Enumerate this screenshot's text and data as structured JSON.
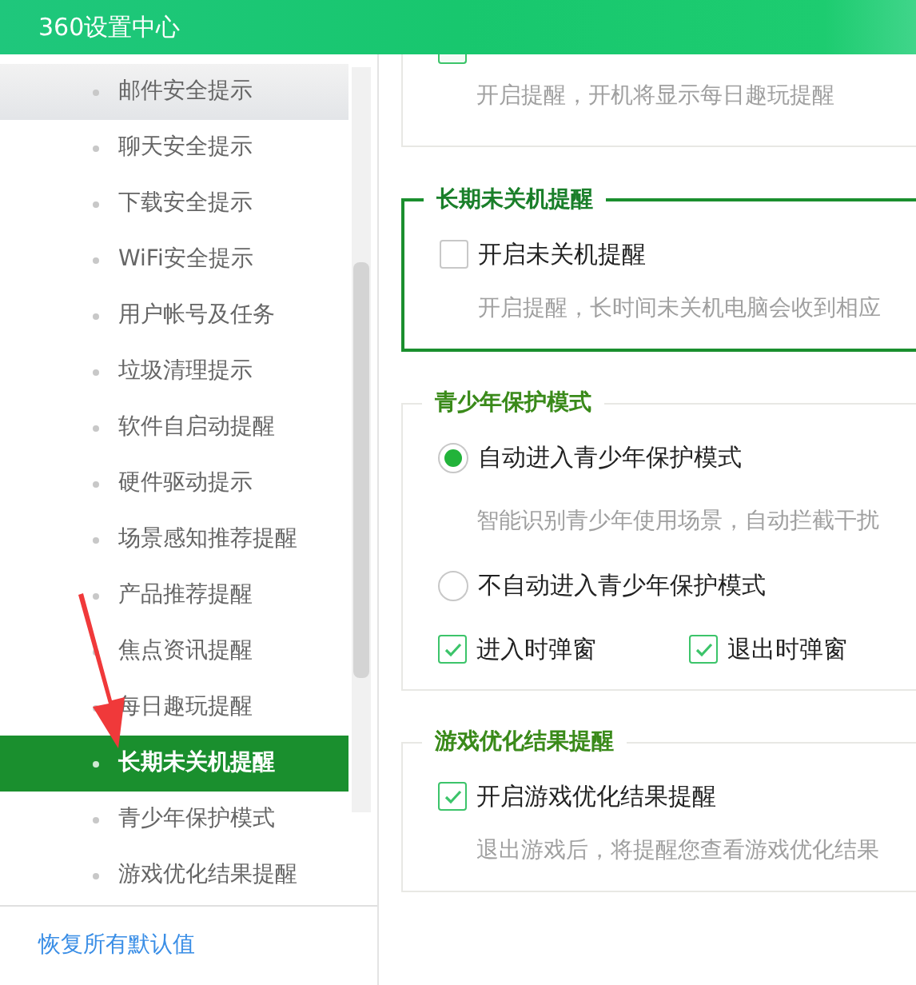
{
  "window": {
    "title": "360设置中心"
  },
  "sidebar": {
    "items": [
      {
        "label": "邮件安全提示",
        "selected": false,
        "hovered": true
      },
      {
        "label": "聊天安全提示",
        "selected": false,
        "hovered": false
      },
      {
        "label": "下载安全提示",
        "selected": false,
        "hovered": false
      },
      {
        "label": "WiFi安全提示",
        "selected": false,
        "hovered": false
      },
      {
        "label": "用户帐号及任务",
        "selected": false,
        "hovered": false
      },
      {
        "label": "垃圾清理提示",
        "selected": false,
        "hovered": false
      },
      {
        "label": "软件自启动提醒",
        "selected": false,
        "hovered": false
      },
      {
        "label": "硬件驱动提示",
        "selected": false,
        "hovered": false
      },
      {
        "label": "场景感知推荐提醒",
        "selected": false,
        "hovered": false
      },
      {
        "label": "产品推荐提醒",
        "selected": false,
        "hovered": false
      },
      {
        "label": "焦点资讯提醒",
        "selected": false,
        "hovered": false
      },
      {
        "label": "每日趣玩提醒",
        "selected": false,
        "hovered": false
      },
      {
        "label": "长期未关机提醒",
        "selected": true,
        "hovered": false
      },
      {
        "label": "青少年保护模式",
        "selected": false,
        "hovered": false
      },
      {
        "label": "游戏优化结果提醒",
        "selected": false,
        "hovered": false
      }
    ]
  },
  "restore_link": "恢复所有默认值",
  "sections": [
    {
      "highlighted": false,
      "rows": [
        {
          "kind": "checkbox",
          "label": null,
          "checked": true
        },
        {
          "kind": "note",
          "text": "开启提醒，开机将显示每日趣玩提醒"
        }
      ]
    },
    {
      "title": "长期未关机提醒",
      "highlighted": true,
      "rows": [
        {
          "kind": "checkbox",
          "label": "开启未关机提醒",
          "checked": false
        },
        {
          "kind": "note",
          "text": "开启提醒，长时间未关机电脑会收到相应"
        }
      ]
    },
    {
      "title": "青少年保护模式",
      "highlighted": false,
      "rows": [
        {
          "kind": "radio",
          "label": "自动进入青少年保护模式",
          "selected": true
        },
        {
          "kind": "note",
          "text": "智能识别青少年使用场景，自动拦截干扰"
        },
        {
          "kind": "radio",
          "label": "不自动进入青少年保护模式",
          "selected": false
        },
        {
          "kind": "checkpair",
          "items": [
            {
              "label": "进入时弹窗",
              "checked": true
            },
            {
              "label": "退出时弹窗",
              "checked": true
            }
          ]
        }
      ]
    },
    {
      "title": "游戏优化结果提醒",
      "highlighted": false,
      "rows": [
        {
          "kind": "checkbox",
          "label": "开启游戏优化结果提醒",
          "checked": true
        },
        {
          "kind": "note",
          "text": "退出游戏后，将提醒您查看游戏优化结果"
        }
      ]
    }
  ]
}
